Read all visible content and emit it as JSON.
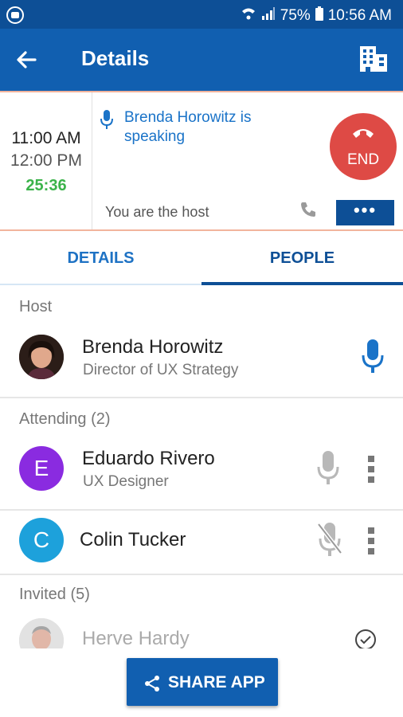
{
  "status_bar": {
    "battery": "75%",
    "time": "10:56 AM"
  },
  "app_bar": {
    "title": "Details"
  },
  "call": {
    "start_time": "11:00 AM",
    "end_time": "12:00 PM",
    "duration": "25:36",
    "speaking_text": "Brenda Horowitz is speaking",
    "host_text": "You are the host",
    "end_label": "END",
    "more_label": "•••"
  },
  "tabs": [
    {
      "label": "DETAILS"
    },
    {
      "label": "PEOPLE"
    }
  ],
  "host_section": {
    "label": "Host",
    "person": {
      "name": "Brenda Horowitz",
      "role": "Director of UX Strategy"
    }
  },
  "attending_section": {
    "label": "Attending (2)",
    "people": [
      {
        "initial": "E",
        "name": "Eduardo Rivero",
        "role": "UX Designer",
        "avatar_color": "#8a2be0"
      },
      {
        "initial": "C",
        "name": "Colin Tucker",
        "role": "",
        "avatar_color": "#1da1db"
      }
    ]
  },
  "invited_section": {
    "label": "Invited (5)",
    "people": [
      {
        "name": "Herve Hardy"
      }
    ]
  },
  "share_button": {
    "label": "SHARE APP"
  },
  "colors": {
    "primary": "#115fb0",
    "status_bar": "#0d4f96",
    "end_button": "#de4a45",
    "duration": "#3bb34a",
    "speaking_text": "#1a73c8"
  }
}
